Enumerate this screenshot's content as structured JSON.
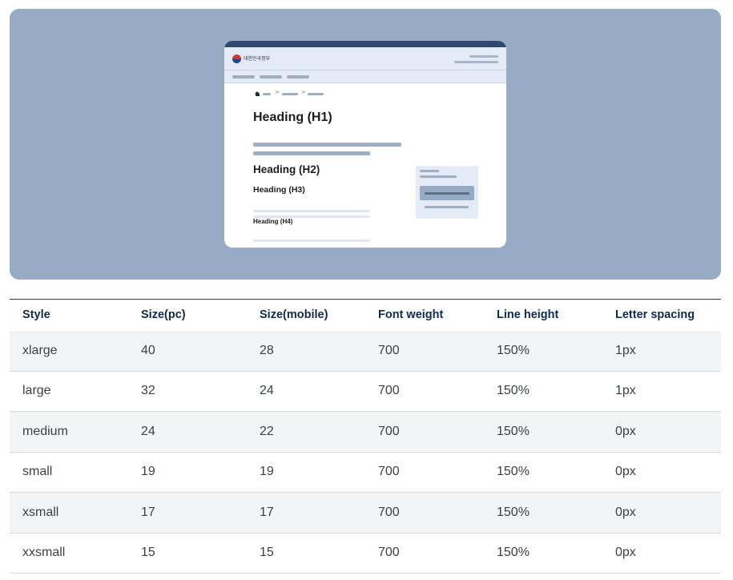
{
  "preview": {
    "gov_name": "대한민국정부",
    "breadcrumb_separator": ">",
    "headings": {
      "h1": "Heading (H1)",
      "h2": "Heading (H2)",
      "h3": "Heading (H3)",
      "h4": "Heading (H4)"
    },
    "colors": {
      "hero_bg": "#97abc4",
      "header_bg": "#e5ebf6",
      "topbar": "#2f4a6b"
    }
  },
  "table": {
    "columns": [
      "Style",
      "Size(pc)",
      "Size(mobile)",
      "Font weight",
      "Line height",
      "Letter spacing"
    ],
    "rows": [
      [
        "xlarge",
        "40",
        "28",
        "700",
        "150%",
        "1px"
      ],
      [
        "large",
        "32",
        "24",
        "700",
        "150%",
        "1px"
      ],
      [
        "medium",
        "24",
        "22",
        "700",
        "150%",
        "0px"
      ],
      [
        "small",
        "19",
        "19",
        "700",
        "150%",
        "0px"
      ],
      [
        "xsmall",
        "17",
        "17",
        "700",
        "150%",
        "0px"
      ],
      [
        "xxsmall",
        "15",
        "15",
        "700",
        "150%",
        "0px"
      ]
    ]
  }
}
